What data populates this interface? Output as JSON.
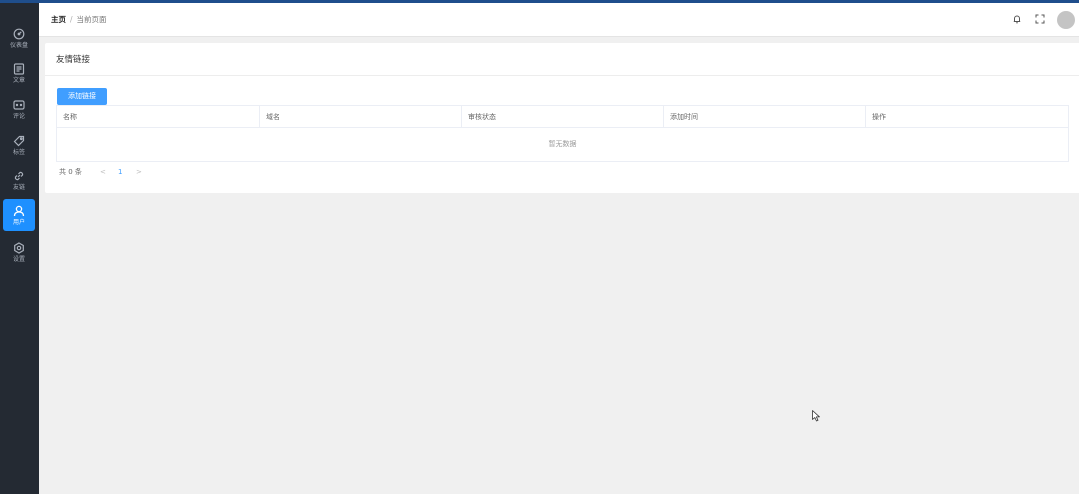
{
  "sidebar": {
    "items": [
      {
        "label": "仪表盘",
        "icon": "dashboard-icon"
      },
      {
        "label": "文章",
        "icon": "article-icon"
      },
      {
        "label": "评论",
        "icon": "comment-icon"
      },
      {
        "label": "标签",
        "icon": "tag-icon"
      },
      {
        "label": "友链",
        "icon": "link-icon"
      },
      {
        "label": "用户",
        "icon": "user-icon",
        "active": true
      },
      {
        "label": "设置",
        "icon": "settings-icon"
      }
    ],
    "active_color": "#1e90ff"
  },
  "header": {
    "breadcrumb": {
      "home": "主页",
      "separator": "/",
      "current": "当前页面"
    },
    "icons": [
      "bell-icon",
      "fullscreen-icon",
      "avatar"
    ]
  },
  "card": {
    "title": "友情链接",
    "add_button_label": "添加链接",
    "table": {
      "columns": [
        "名称",
        "域名",
        "审核状态",
        "添加时间",
        "操作"
      ],
      "rows": [],
      "empty_text": "暂无数据"
    },
    "pagination": {
      "total_text": "共 0 条",
      "prev": "<",
      "current_page": "1",
      "next": ">"
    }
  },
  "colors": {
    "primary": "#409eff",
    "sidebar_bg": "#242a33",
    "topline": "#1f4e8c"
  }
}
